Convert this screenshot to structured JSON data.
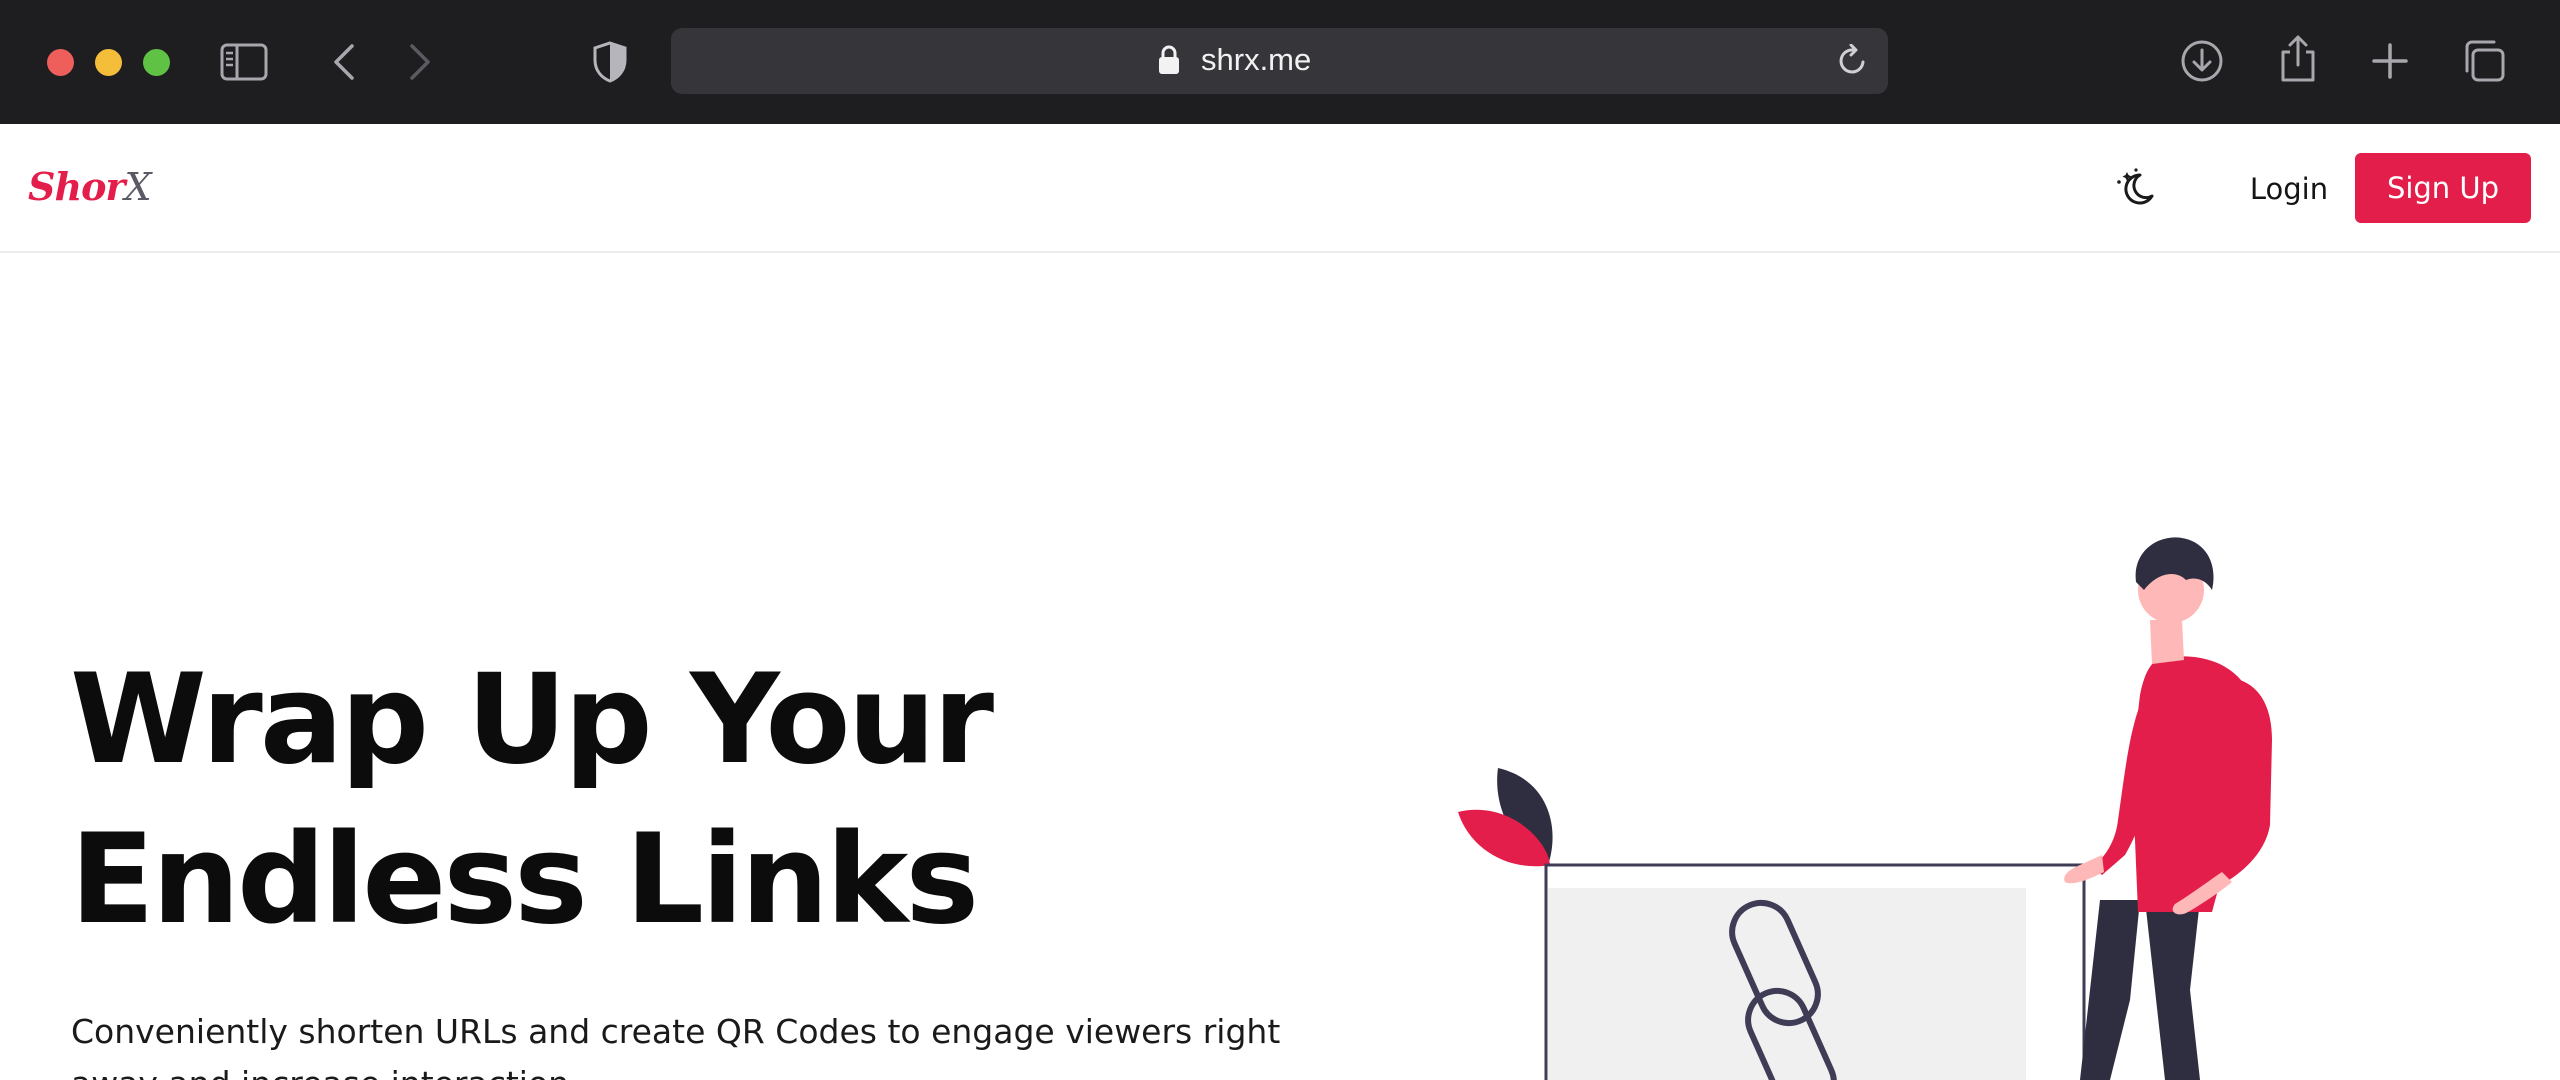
{
  "browser": {
    "url": "shrx.me",
    "icons": [
      "sidebar-icon",
      "back-icon",
      "forward-icon",
      "shield-icon",
      "lock-icon",
      "reload-icon",
      "download-icon",
      "share-icon",
      "new-tab-icon",
      "tab-overview-icon"
    ]
  },
  "header": {
    "brand_part1": "Shor",
    "brand_part2": "X",
    "theme_icon": "moon-stars-icon",
    "login_label": "Login",
    "signup_label": "Sign Up"
  },
  "hero": {
    "title_line1": "Wrap Up Your",
    "title_line2": "Endless Links",
    "subtitle": "Conveniently shorten URLs and create QR Codes to engage viewers right away and increase interaction."
  },
  "colors": {
    "accent": "#e31e4a",
    "chrome_bg": "#1e1e21",
    "urlbar_bg": "#36363a",
    "text_dark": "#0c0c0c",
    "illustration_dark": "#2f2e41"
  }
}
